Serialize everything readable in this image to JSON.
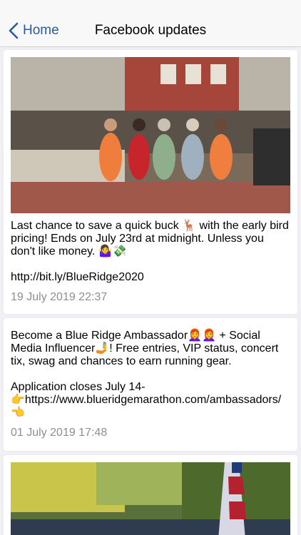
{
  "nav": {
    "back_label": "Home",
    "title": "Facebook updates"
  },
  "posts": [
    {
      "text": "Last chance to save a quick buck 🦌 with the early bird pricing! Ends on July 23rd at midnight. Unless you don't like money. 🤷‍♀️💸\n\nhttp://bit.ly/BlueRidge2020",
      "date": "19 July 2019 22:37",
      "image": "race-runners-photo"
    },
    {
      "text": "Become a Blue Ridge Ambassador👩‍🦰👩‍🦰 + Social Media Influencer🤳! Free entries, VIP status, concert tix, swag and chances to earn running gear.\n\nApplication closes July 14-\n👉https://www.blueridgemarathon.com/ambassadors/👈",
      "date": "01 July 2019 17:48"
    },
    {
      "image": "marathon-crowd-flag-photo"
    }
  ],
  "colors": {
    "accent": "#2a5aa6",
    "background": "#efeff4",
    "muted_text": "#8e8e93"
  }
}
